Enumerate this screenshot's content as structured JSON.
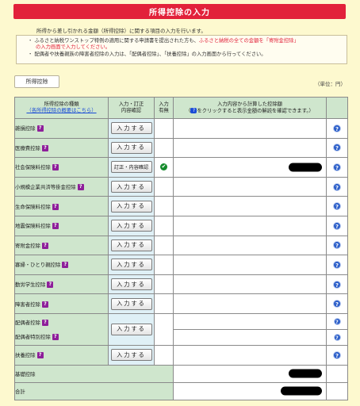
{
  "page": {
    "title": "所得控除の入力",
    "intro": "所得から差し引かれる金額（所得控除）に関する項目の入力を行います。"
  },
  "notice": {
    "line1_a": "ふるさと納税ワンストップ特例の適用に関する申請書を提出された方も、",
    "line1_red": "ふるさと納税の全ての金額を「寄附金控除」",
    "line1_b_red": "の入力画面で入力してください。",
    "line2": "配偶者や扶養親族の障害者控除の入力は、「配偶者控除」、「扶養控除」の入力画面から行ってください。"
  },
  "tab": {
    "label": "所得控除"
  },
  "unit_label": "（単位：円）",
  "table": {
    "headers": {
      "kind": "所得控除の種類",
      "kind_link": "（各所得控除の概要はこちら）",
      "input": "入力・訂正\n内容確認",
      "has_input": "入力\n有無",
      "calc_line1": "入力内容から計算した控除額",
      "calc_line2": "をクリックすると表示金額の解説を確認できます。）",
      "calc_prefix": "（",
      "q_glyph": "?"
    },
    "help_chip": "?",
    "help_icon": "?",
    "input_button": "入力する",
    "edit_button": "訂正・内容確認",
    "check_glyph": "✔",
    "rows": [
      {
        "name": "雑損控除"
      },
      {
        "name": "医療費控除"
      },
      {
        "name": "社会保険料控除"
      },
      {
        "name": "小規模企業共済等掛金控除"
      },
      {
        "name": "生命保険料控除"
      },
      {
        "name": "地震保険料控除"
      },
      {
        "name": "寄附金控除"
      },
      {
        "name": "寡婦・ひとり親控除"
      },
      {
        "name": "勤労学生控除"
      },
      {
        "name": "障害者控除"
      },
      {
        "name": "配偶者控除",
        "name2": "配偶者特別控除"
      },
      {
        "name": "扶養控除"
      },
      {
        "name": "基礎控除"
      },
      {
        "name": "合計"
      }
    ]
  }
}
